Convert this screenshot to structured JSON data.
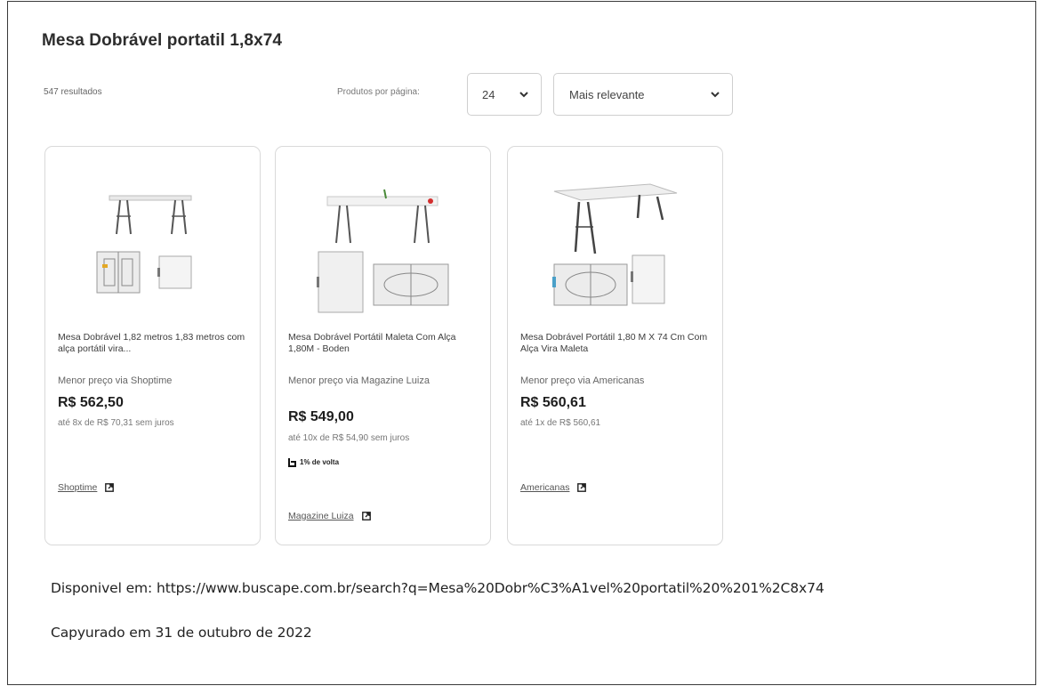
{
  "page": {
    "title": "Mesa Dobrável portatil 1,8x74",
    "results_count": "547 resultados",
    "per_page_label": "Produtos por página:",
    "per_page_value": "24",
    "sort_value": "Mais relevante"
  },
  "products": [
    {
      "name": "Mesa Dobrável 1,82 metros 1,83 metros com alça portátil vira...",
      "via": "Menor preço via Shoptime",
      "price": "R$ 562,50",
      "installments": "até 8x de R$ 70,31 sem juros",
      "store": "Shoptime"
    },
    {
      "name": "Mesa Dobrável Portátil Maleta Com Alça 1,80M - Boden",
      "via": "Menor preço via Magazine Luiza",
      "price": "R$ 549,00",
      "installments": "até 10x de R$ 54,90 sem juros",
      "cashback": "1% de volta",
      "store": "Magazine Luiza"
    },
    {
      "name": "Mesa Dobrável Portátil 1,80 M X 74 Cm Com Alça Vira Maleta",
      "via": "Menor preço via Americanas",
      "price": "R$ 560,61",
      "installments": "até 1x de R$ 560,61",
      "store": "Americanas"
    }
  ],
  "footer": {
    "source": "Disponivel em: https://www.buscape.com.br/search?q=Mesa%20Dobr%C3%A1vel%20portatil%20%201%2C8x74",
    "captured": "Capyurado em 31 de outubro de 2022"
  },
  "icons": {
    "chevron": "chevron-down-icon",
    "external": "external-link-icon",
    "cashback": "cashback-icon"
  },
  "colors": {
    "border": "#d9d9d9",
    "text": "#2b2b2b",
    "muted": "#777777"
  }
}
